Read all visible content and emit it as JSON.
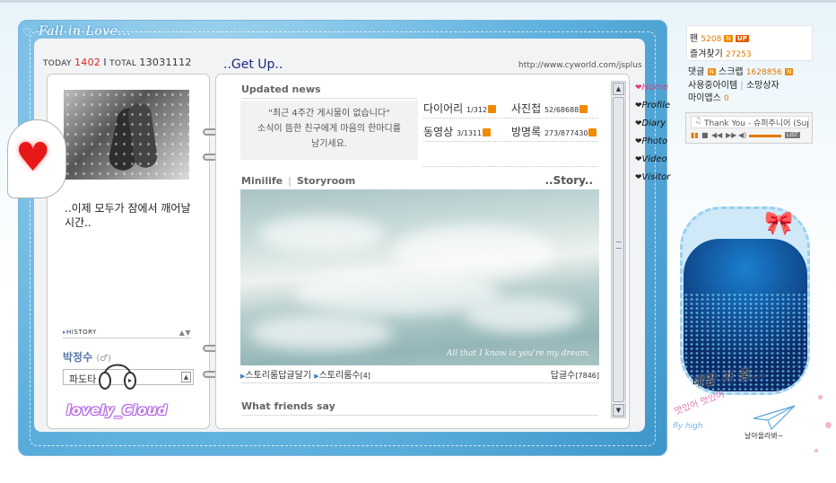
{
  "frame": {
    "title": "Fall in Love..."
  },
  "counter": {
    "today_label": "TODAY",
    "today_value": "1402",
    "sep": "I",
    "total_label": "TOTAL",
    "total_value": "13031112"
  },
  "left": {
    "mood": "..이제 모두가 잠에서 깨어날 시간..",
    "history_label": "HISTORY",
    "name": "박정수",
    "gender": "(♂)",
    "wave_value": "파도타",
    "signature": "lovely_Cloud"
  },
  "right": {
    "title": "..Get Up..",
    "url": "http://www.cyworld.com/jsplus",
    "updated": {
      "header": "Updated news",
      "empty_line1": "\"최근 4주간 게시물이 없습니다\"",
      "empty_line2": "소식이 뜸한 친구에게 마음의 한마디를",
      "empty_line3": "남기세요."
    },
    "stats": [
      {
        "label": "다이어리",
        "count": "1/312"
      },
      {
        "label": "사진첩",
        "count": "52/68688"
      },
      {
        "label": "동영상",
        "count": "3/1311"
      },
      {
        "label": "방명록",
        "count": "273/877430"
      }
    ],
    "minilife": {
      "tab1": "Minilife",
      "tab2": "Storyroom",
      "story": "..Story..",
      "caption": "All that I know is you're my dream.",
      "link1": "스토리룸답글달기",
      "link2": "스토리룸수",
      "link2_count": "[4]",
      "reply_label": "답글수",
      "reply_count": "[7846]"
    },
    "friends_header": "What friends say"
  },
  "menu": [
    {
      "label": "Home",
      "active": true
    },
    {
      "label": "Profile"
    },
    {
      "label": "Diary"
    },
    {
      "label": "Photo"
    },
    {
      "label": "Video"
    },
    {
      "label": "Visitor"
    }
  ],
  "sidebar": {
    "fan_label": "팬",
    "fan_count": "5208",
    "badge_n": "N",
    "badge_up": "UP",
    "bookmark_label": "즐겨찾기",
    "bookmark_count": "27253",
    "comment_label": "댓글",
    "scrap_label": "스크랩",
    "scrap_count": "1628856",
    "items_label": "사용중아이템",
    "shop_label": "소망상자",
    "mine_label": "마이앱스",
    "mine_count": "0"
  },
  "player": {
    "song": "Thank You - 슈퍼주니어 (Sup",
    "list": "LIST"
  },
  "deco": {
    "text": "네잎 가 중...",
    "sub": "멋있어 멋있어",
    "fly": "fly high",
    "bird": "날아올라봐~"
  },
  "colors": {
    "accent": "#e07a00",
    "frame": "#5fb1de",
    "menu_active": "#e0407a"
  }
}
